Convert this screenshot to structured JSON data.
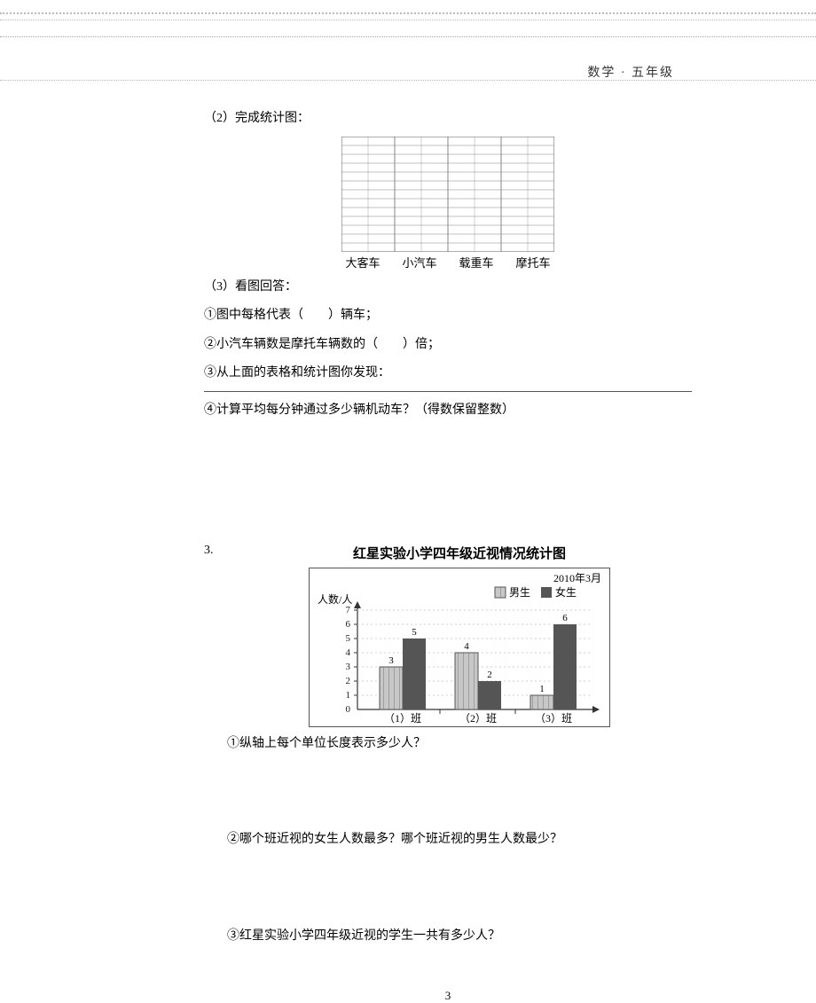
{
  "header": {
    "label": "数学 · 五年级"
  },
  "q2": {
    "prompt": "（2）完成统计图：",
    "categories": [
      "大客车",
      "小汽车",
      "载重车",
      "摩托车"
    ],
    "q3_heading": "（3）看图回答：",
    "s1": "①图中每格代表（　　）辆车；",
    "s2": "②小汽车辆数是摩托车辆数的（　　）倍；",
    "s3": "③从上面的表格和统计图你发现：",
    "s4": "④计算平均每分钟通过多少辆机动车？（得数保留整数）"
  },
  "q3": {
    "num": "3.",
    "title": "红星实验小学四年级近视情况统计图",
    "date": "2010年3月",
    "legend": {
      "male": "男生",
      "female": "女生"
    },
    "ylabel": "人数/人",
    "sub1": "①纵轴上每个单位长度表示多少人？",
    "sub2": "②哪个班近视的女生人数最多？哪个班近视的男生人数最少？",
    "sub3": "③红星实验小学四年级近视的学生一共有多少人？"
  },
  "chart_data": {
    "type": "bar",
    "title": "红星实验小学四年级近视情况统计图",
    "ylabel": "人数/人",
    "ylim": [
      0,
      7
    ],
    "yticks": [
      0,
      1,
      2,
      3,
      4,
      5,
      6,
      7
    ],
    "categories": [
      "（1）班",
      "（2）班",
      "（3）班"
    ],
    "series": [
      {
        "name": "男生",
        "values": [
          3,
          4,
          1
        ]
      },
      {
        "name": "女生",
        "values": [
          5,
          2,
          6
        ]
      }
    ]
  },
  "footer": {
    "page": "3"
  }
}
